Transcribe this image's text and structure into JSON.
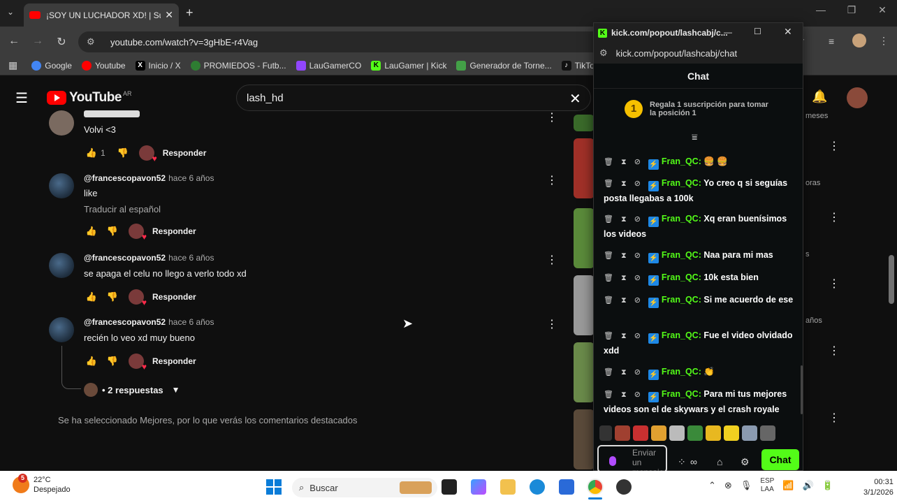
{
  "browser": {
    "tab_title": "¡SOY UN LUCHADOR XD! | Sup",
    "new_tab": "+",
    "url": "youtube.com/watch?v=3gHbE-r4Vag",
    "bookmarks": [
      {
        "label": "Google",
        "icon": "google-icon",
        "color": "#4285f4"
      },
      {
        "label": "Youtube",
        "icon": "youtube-icon",
        "color": "#ff0000"
      },
      {
        "label": "Inicio / X",
        "icon": "x-icon",
        "color": "#000000"
      },
      {
        "label": "PROMIEDOS - Futb...",
        "icon": "promiedos-icon",
        "color": "#2e7d32"
      },
      {
        "label": "LauGamerCO",
        "icon": "twitch-icon",
        "color": "#9146ff"
      },
      {
        "label": "LauGamer | Kick",
        "icon": "kick-icon",
        "color": "#53fc18"
      },
      {
        "label": "Generador de Torne...",
        "icon": "generator-icon",
        "color": "#43a047"
      },
      {
        "label": "TikTok",
        "icon": "tiktok-icon",
        "color": "#111111"
      }
    ]
  },
  "youtube": {
    "logo_text": "YouTube",
    "region": "AR",
    "search_value": "lash_hd",
    "comments": [
      {
        "author": "",
        "time": "",
        "text": "Volvi <3",
        "likes": "1",
        "translate": "",
        "reply": "Responder"
      },
      {
        "author": "@francescopavon52",
        "time": "hace 6 años",
        "text": "like",
        "likes": "",
        "translate": "Traducir al español",
        "reply": "Responder"
      },
      {
        "author": "@francescopavon52",
        "time": "hace 6 años",
        "text": "se apaga el celu no llego a verlo todo xd",
        "likes": "",
        "translate": "",
        "reply": "Responder"
      },
      {
        "author": "@francescopavon52",
        "time": "hace 6 años",
        "text": "recién lo veo xd muy bueno",
        "likes": "",
        "translate": "",
        "reply": "Responder"
      }
    ],
    "replies_toggle": "• 2 respuestas",
    "best_note": "Se ha seleccionado Mejores, por lo que verás los comentarios destacados",
    "sidebar_snippets": [
      "meses",
      "oras",
      "s",
      "años"
    ]
  },
  "kick": {
    "window_title": "kick.com/popout/lashcabj/c...",
    "url": "kick.com/popout/lashcabj/chat",
    "chat_title": "Chat",
    "gift_rank": "1",
    "gift_text_1": "Regala 1 suscripción para tomar",
    "gift_text_2": "la posición 1",
    "messages": [
      {
        "user": "Fran_QC:",
        "text": "🍔 🍔"
      },
      {
        "user": "Fran_QC:",
        "text": "Yo creo q si seguías posta llegabas a 100k"
      },
      {
        "user": "Fran_QC:",
        "text": "Xq eran buenísimos los videos"
      },
      {
        "user": "Fran_QC:",
        "text": "Naa para mi mas"
      },
      {
        "user": "Fran_QC:",
        "text": "10k esta bien"
      },
      {
        "user": "Fran_QC:",
        "text": "Si me acuerdo de ese"
      },
      {
        "user": "Fran_QC:",
        "text": "Fue el video olvidado xdd"
      },
      {
        "user": "Fran_QC:",
        "text": "👏"
      },
      {
        "user": "Fran_QC:",
        "text": "Para mi tus mejores videos son el de skywars y el crash royale"
      }
    ],
    "input_placeholder": "Enviar un mensaje",
    "send_button": "Chat",
    "accent": "#53fc18"
  },
  "taskbar": {
    "weather_badge": "5",
    "temperature": "22°C",
    "weather_text": "Despejado",
    "search_placeholder": "Buscar",
    "lang_1": "ESP",
    "lang_2": "LAA",
    "time": "00:31",
    "date": "3/1/2026"
  }
}
